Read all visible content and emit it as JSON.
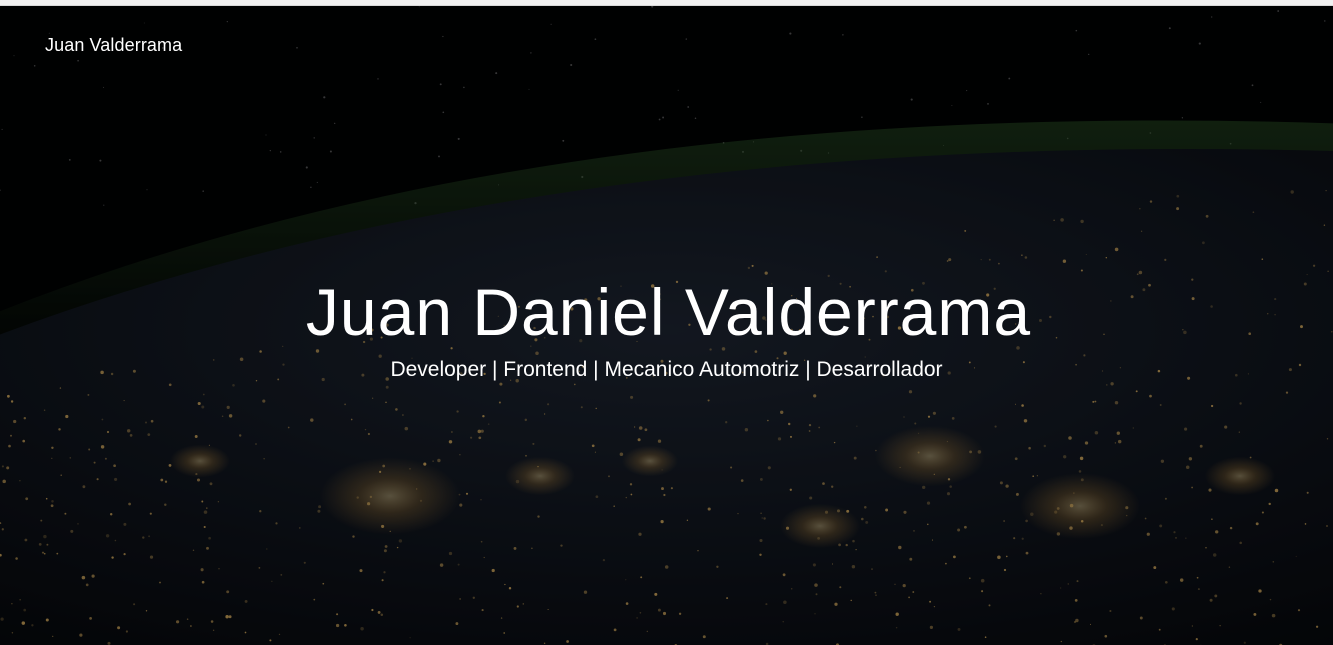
{
  "navbar": {
    "brand_label": "Juan Valderrama"
  },
  "hero": {
    "title": "Juan Daniel Valderrama",
    "subtitle": "Developer | Frontend | Mecanico Automotriz | Desarrollador",
    "background_description": "night-earth-city-lights",
    "overlay_color": "#000000",
    "city_light_color": "#f5c46a",
    "atmosphere_color": "#2f5a2a"
  }
}
